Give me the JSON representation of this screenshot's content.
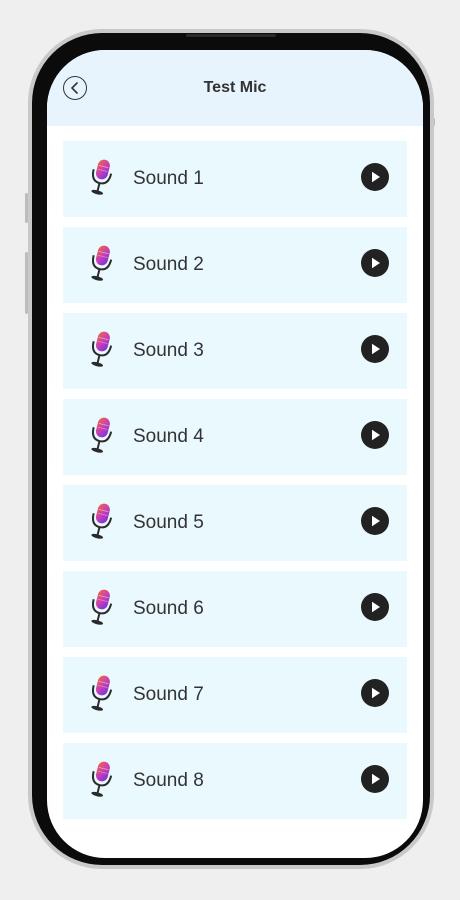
{
  "header": {
    "title": "Test Mic",
    "back_icon": "chevron-left-icon"
  },
  "sounds": [
    {
      "label": "Sound 1",
      "icon": "microphone-icon",
      "action_icon": "play-icon"
    },
    {
      "label": "Sound 2",
      "icon": "microphone-icon",
      "action_icon": "play-icon"
    },
    {
      "label": "Sound 3",
      "icon": "microphone-icon",
      "action_icon": "play-icon"
    },
    {
      "label": "Sound 4",
      "icon": "microphone-icon",
      "action_icon": "play-icon"
    },
    {
      "label": "Sound 5",
      "icon": "microphone-icon",
      "action_icon": "play-icon"
    },
    {
      "label": "Sound 6",
      "icon": "microphone-icon",
      "action_icon": "play-icon"
    },
    {
      "label": "Sound 7",
      "icon": "microphone-icon",
      "action_icon": "play-icon"
    },
    {
      "label": "Sound 8",
      "icon": "microphone-icon",
      "action_icon": "play-icon"
    }
  ],
  "colors": {
    "header_bg": "#e8f4fd",
    "item_bg": "#eaf9fe",
    "play_button": "#222222",
    "text": "#333333"
  }
}
